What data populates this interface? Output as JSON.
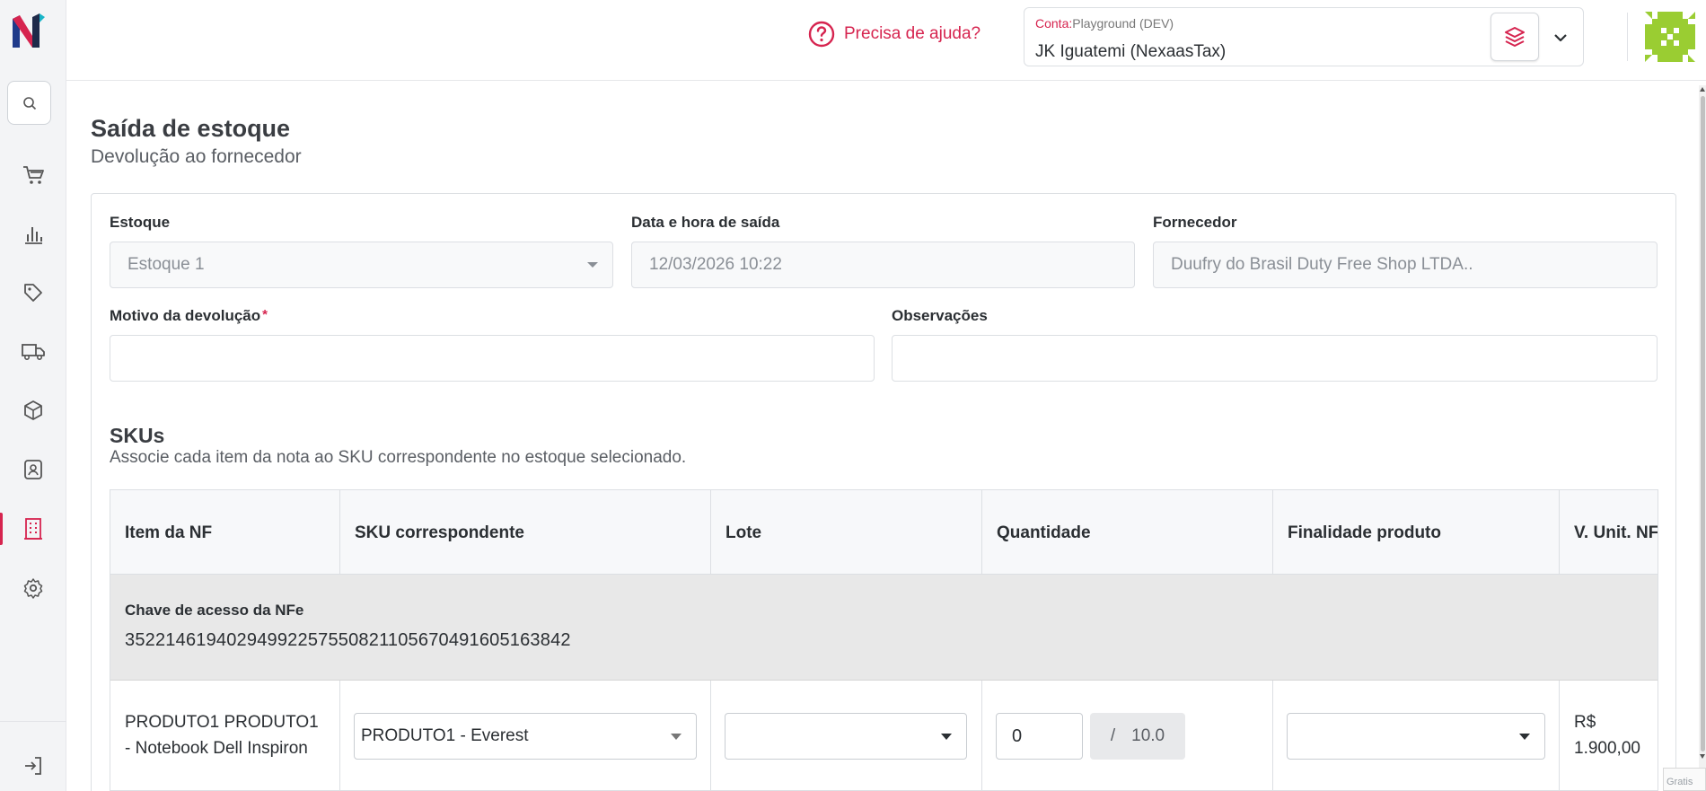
{
  "colors": {
    "accent": "#d6244f",
    "sidebar_bg": "#f3f4f6",
    "nfe_row_bg": "#e8e8e8",
    "avatar": "#9acd32"
  },
  "sidebar": {
    "logo": "nexaas-logo",
    "items": [
      {
        "icon": "cart-icon"
      },
      {
        "icon": "bar-chart-icon"
      },
      {
        "icon": "tag-icon"
      },
      {
        "icon": "truck-icon"
      },
      {
        "icon": "box-icon"
      },
      {
        "icon": "contact-card-icon"
      },
      {
        "icon": "building-icon",
        "active": true
      },
      {
        "icon": "gear-icon"
      }
    ],
    "logout_icon": "logout-icon"
  },
  "header": {
    "help_text": "Precisa de ajuda?",
    "account_key": "Conta:",
    "account_env": "Playground (DEV)",
    "account_name": "JK Iguatemi (NexaasTax)"
  },
  "page": {
    "title": "Saída de estoque",
    "subtitle": "Devolução ao fornecedor"
  },
  "form": {
    "estoque": {
      "label": "Estoque",
      "value": "Estoque 1"
    },
    "data_saida": {
      "label": "Data e hora de saída",
      "value": "12/03/2026 10:22"
    },
    "fornecedor": {
      "label": "Fornecedor",
      "value": "Duufry do Brasil Duty Free Shop LTDA.."
    },
    "motivo": {
      "label": "Motivo da devolução",
      "required_mark": "*",
      "value": ""
    },
    "observacoes": {
      "label": "Observações",
      "value": ""
    }
  },
  "skus": {
    "title": "SKUs",
    "description": "Associe cada item da nota ao SKU correspondente no estoque selecionado.",
    "columns": [
      "Item da NF",
      "SKU correspondente",
      "Lote",
      "Quantidade",
      "Finalidade produto",
      "V. Unit. NF"
    ],
    "nfe_label": "Chave de acesso da NFe",
    "nfe_key": "35221461940294992257550821105670491605163842",
    "rows": [
      {
        "item": "PRODUTO1 PRODUTO1 - Notebook Dell Inspiron",
        "sku": "PRODUTO1 - Everest",
        "lote": "",
        "quantidade": "0",
        "quantidade_sep": "/",
        "quantidade_max": "10.0",
        "finalidade": "",
        "v_unit_currency": "R$",
        "v_unit_value": "1.900,00"
      }
    ]
  },
  "corner_badge": "Gratis"
}
